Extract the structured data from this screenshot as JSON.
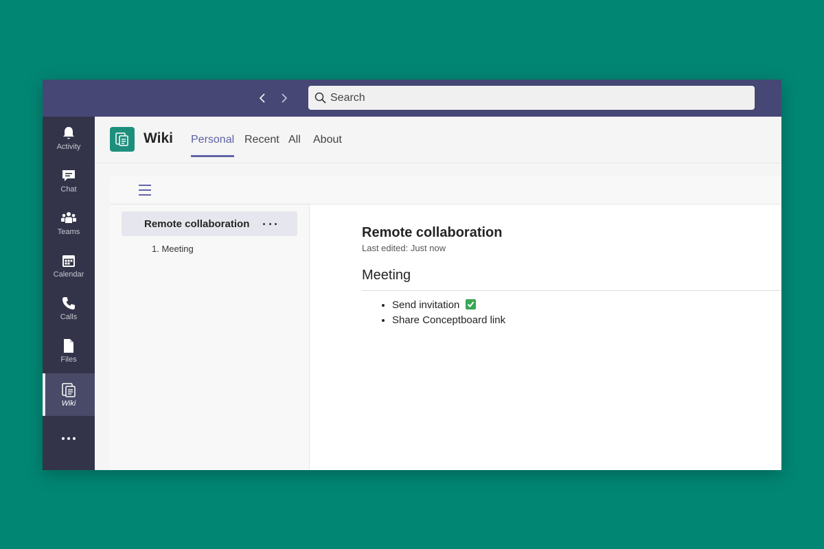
{
  "search": {
    "placeholder": "Search"
  },
  "rail": {
    "items": [
      {
        "label": "Activity",
        "icon": "bell-icon"
      },
      {
        "label": "Chat",
        "icon": "chat-icon"
      },
      {
        "label": "Teams",
        "icon": "teams-icon"
      },
      {
        "label": "Calendar",
        "icon": "calendar-icon"
      },
      {
        "label": "Calls",
        "icon": "phone-icon"
      },
      {
        "label": "Files",
        "icon": "file-icon"
      },
      {
        "label": "Wiki",
        "icon": "wiki-icon",
        "active": true
      }
    ],
    "more_icon": "more-icon"
  },
  "app": {
    "title": "Wiki",
    "tabs": [
      {
        "label": "Personal",
        "active": true
      },
      {
        "label": "Recent"
      },
      {
        "label": "All"
      },
      {
        "label": "About"
      }
    ]
  },
  "sidebar": {
    "section": "Remote collaboration",
    "pages": [
      "1. Meeting"
    ]
  },
  "article": {
    "title": "Remote collaboration",
    "meta": "Last edited: Just now",
    "heading": "Meeting",
    "bullets": [
      {
        "text": "Send invitation",
        "icon": "check-mark-icon"
      },
      {
        "text": "Share Conceptboard link"
      }
    ]
  },
  "colors": {
    "background": "#028674",
    "topbar": "#464775",
    "rail": "#33344a",
    "accent": "#6264a7",
    "app_logo": "#1e8f7d",
    "check": "#3aa656"
  }
}
